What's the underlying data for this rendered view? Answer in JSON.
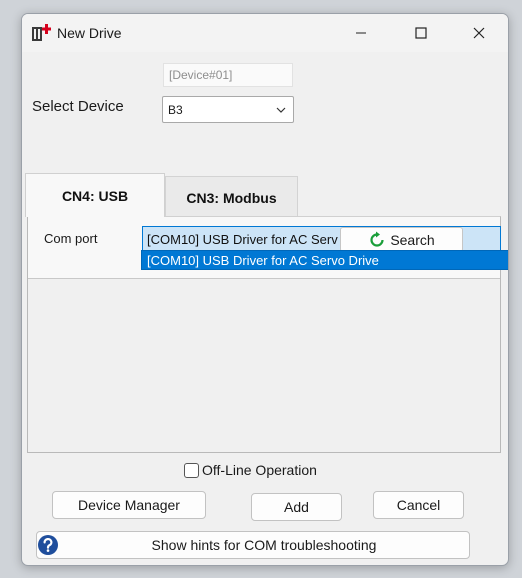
{
  "window": {
    "title": "New Drive"
  },
  "device": {
    "id_placeholder": "[Device#01]",
    "select_label": "Select Device",
    "selected": "B3"
  },
  "tabs": [
    {
      "label": "CN4: USB",
      "active": true
    },
    {
      "label": "CN3: Modbus",
      "active": false
    }
  ],
  "usb": {
    "com_label": "Com port",
    "com_value": "[COM10] USB Driver for AC Serv",
    "search_label": "Search",
    "dropdown_options": [
      "[COM10] USB Driver for AC Servo Drive"
    ]
  },
  "options": {
    "offline_label": "Off-Line Operation"
  },
  "buttons": {
    "device_manager": "Device Manager",
    "add": "Add",
    "cancel": "Cancel",
    "hints": "Show hints for COM troubleshooting"
  },
  "icons": {
    "app": "app-logo-icon",
    "search": "refresh-icon",
    "help": "help-icon"
  },
  "colors": {
    "accent": "#0078d4",
    "selection": "#cce4f7",
    "search_icon": "#1a9e3a",
    "help_icon": "#1f4e9c"
  }
}
